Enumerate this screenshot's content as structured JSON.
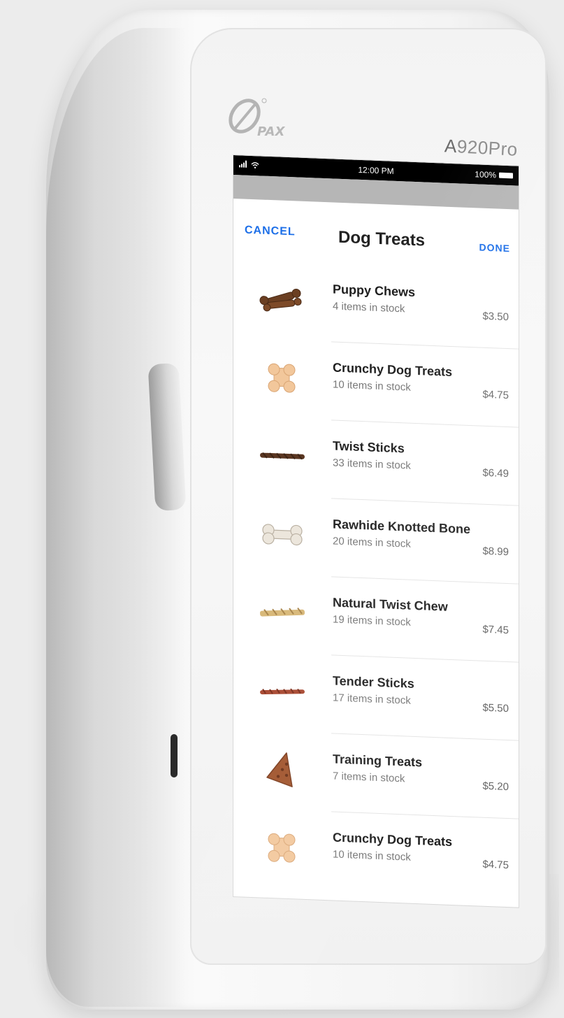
{
  "device": {
    "brand": "PAX",
    "model_prefix": "A",
    "model_suffix": "920Pro"
  },
  "status_bar": {
    "time": "12:00 PM",
    "battery": "100%"
  },
  "nav": {
    "cancel_label": "CANCEL",
    "title": "Dog Treats",
    "done_label": "DONE"
  },
  "items": [
    {
      "name": "Puppy Chews",
      "stock": "4 items in stock",
      "price": "$3.50",
      "thumb": "bone-cluster"
    },
    {
      "name": "Crunchy Dog Treats",
      "stock": "10 items in stock",
      "price": "$4.75",
      "thumb": "biscuit-bone"
    },
    {
      "name": "Twist Sticks",
      "stock": "33 items in stock",
      "price": "$6.49",
      "thumb": "twist-stick-dark"
    },
    {
      "name": "Rawhide Knotted Bone",
      "stock": "20 items in stock",
      "price": "$8.99",
      "thumb": "rawhide-bone"
    },
    {
      "name": "Natural Twist Chew",
      "stock": "19 items in stock",
      "price": "$7.45",
      "thumb": "twist-stick-light"
    },
    {
      "name": "Tender Sticks",
      "stock": "17 items in stock",
      "price": "$5.50",
      "thumb": "twist-stick-red"
    },
    {
      "name": "Training Treats",
      "stock": "7 items in stock",
      "price": "$5.20",
      "thumb": "triangle-treat"
    },
    {
      "name": "Crunchy Dog Treats",
      "stock": "10 items in stock",
      "price": "$4.75",
      "thumb": "biscuit-bone"
    }
  ],
  "colors": {
    "accent": "#1d6fe8",
    "status_bar": "#000000",
    "band": "#b6b6b6"
  }
}
